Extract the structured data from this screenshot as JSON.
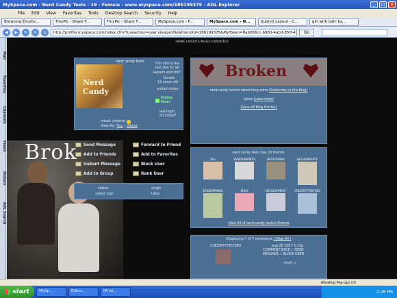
{
  "window": {
    "title": "MySpace.com - Nerd Candy Tests - 19 - Female - www.myspace.com/186199375 - AOL Explorer"
  },
  "menu": [
    "File",
    "Edit",
    "View",
    "Favorites",
    "Tools",
    "Desktop Search",
    "Security",
    "Help"
  ],
  "tabs": [
    "Browsing Emotiv...",
    "TinyPic - Share T...",
    "TinyPic - Share T...",
    "MySpace.com - P...",
    "MySpace.com - N...",
    "Submit Layout - C...",
    "girl with ball- by..."
  ],
  "address": {
    "url": "http://profile.myspace.com/index.cfm?fuseaction=user.viewprofile&friendid=186199375&MyToken=8ab066cc-b980-4abd-85ff-4",
    "go": "Go"
  },
  "sidebar": [
    "Mail",
    "Favorites",
    "Channels",
    "Feeds",
    "History",
    "AOL Search"
  ],
  "page": {
    "topnav": "HOME LAYOUTS MUSIC FAVORITES",
    "banner_text": "Brok",
    "profile": {
      "name": "nerd candy tests",
      "image_text": "Nerd Candy",
      "headline": "\"this site is the test site for all layouts and shit\"",
      "gender": "female",
      "age": "19 years old",
      "location": "united states",
      "online": "Online Now!",
      "last_login_label": "last login:",
      "last_login": "8/23/2007",
      "mood": "mood: creative",
      "view_my": "View My:",
      "pics": "Pics",
      "videos": "Videos"
    },
    "contact": {
      "send_message": "Send Message",
      "forward": "Forward to Friend",
      "add_friends": "Add to Friends",
      "add_favorites": "Add to Favorites",
      "im": "Instant Message",
      "block": "Block User",
      "add_group": "Add to Group",
      "rank": "Rank User"
    },
    "details": {
      "status_label": "status:",
      "status_value": "single",
      "zodiac_label": "zodiac sign",
      "zodiac_value": "Libra"
    },
    "blog": {
      "banner": "Broken",
      "latest": "nerd candy tests's latest blog entry",
      "subscribe": "[Subscribe to this Blog]",
      "entry": "place",
      "more": "[view more]",
      "view_all": "[View All Blog Entries]"
    },
    "friends": {
      "header": "nerd candy tests has 20 friends.",
      "items": [
        "Tom",
        "EVNDRNEMBTS",
        "NERD KAWAI",
        "HELGEMAARTE",
        "EPIDEMPAWKE",
        "ZRUS",
        "DEVELOPMENT",
        "CHEZIRTYTREYERS"
      ],
      "view_all": "View All of nerd candy tests's Friends"
    },
    "comments": {
      "header": "Displaying 7 of 7 comments",
      "view_all": "( View All )",
      "commenter": "CHEZIRTYTREYERS",
      "date": "aug 28 2007 5:23p",
      "actions": "COMMENT BACK :: SEND MESSAGE :: BLOCK USER",
      "text": "heyh :)"
    }
  },
  "statusbar": {
    "text": "Allowing Pop-ups (0)"
  },
  "taskbar": {
    "start": "start",
    "items": [
      "MySp...",
      "Editor...",
      "IM wi..."
    ],
    "clock": "2:28 PM"
  }
}
